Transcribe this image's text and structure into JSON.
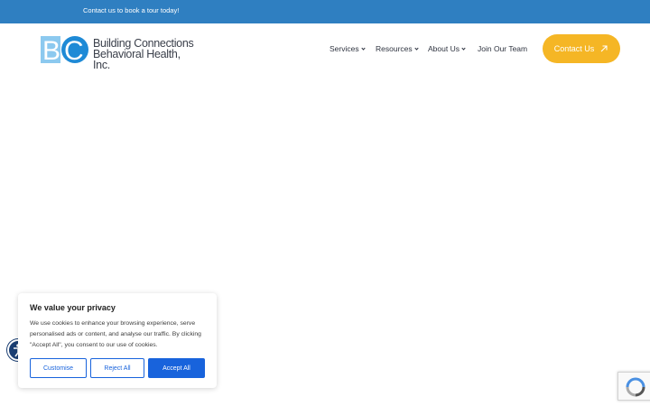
{
  "topbar": {
    "text": "Contact us to book a tour today!"
  },
  "logo": {
    "line1": "Building Connections",
    "line2": "Behavioral Health, Inc."
  },
  "nav": {
    "services": "Services",
    "resources": "Resources",
    "about": "About Us",
    "join": "Join Our Team",
    "contact_button": "Contact Us"
  },
  "cookie": {
    "title": "We value your privacy",
    "body": "We use cookies to enhance your browsing experience, serve personalised ads or content, and analyse our traffic. By clicking \"Accept All\", you consent to our use of cookies.",
    "customise": "Customise",
    "reject": "Reject All",
    "accept": "Accept All"
  },
  "colors": {
    "topbar": "#2f7fc1",
    "accent_button": "#f5b625",
    "cookie_primary": "#1863dc",
    "logo_blue": "#1e8ad6"
  },
  "icons": [
    "accessibility-icon",
    "recaptcha-icon",
    "external-arrow-icon",
    "chevron-down-icon"
  ]
}
